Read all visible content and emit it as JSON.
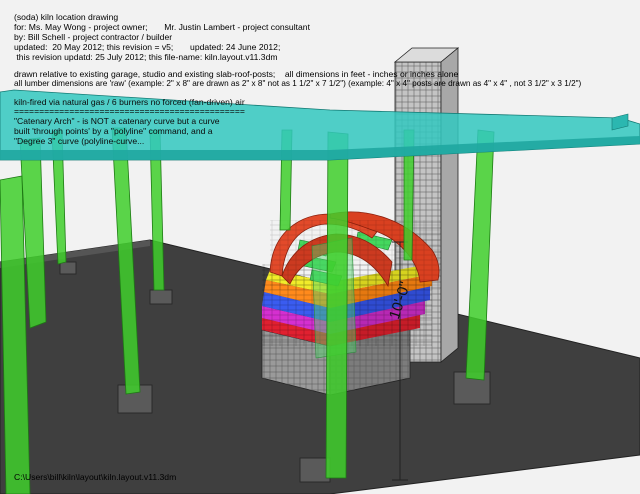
{
  "header": {
    "line1": "(soda) kiln location drawing",
    "line2": "for: Ms. May Wong - project owner;       Mr. Justin Lambert - project consultant",
    "line3": "by: Bill Schell - project contractor / builder",
    "line4": "updated:  20 May 2012; this revision = v5;       updated: 24 June 2012;",
    "line5": " this revision updatd: 25 July 2012; this file-name: kiln.layout.v11.3dm"
  },
  "notes": {
    "line1": "drawn relative to existing garage, studio and existing slab-roof-posts;    all dimensions in feet - inches or inches alone",
    "line2": "all lumber dimensions are 'raw' (example: 2\" x 8\" are drawn as 2\" x 8\" not as 1 1/2\" x 7 1/2\") (example: 4\" x 4\" posts are drawn as 4\" x 4\" , not 3 1/2\" x 3 1/2\")"
  },
  "overlay": {
    "line1": "kiln-fired via natural gas / 6 burners no forced (fan-driven) air",
    "line2": "==============================================",
    "line3": "\"Catenary Arch\" - is NOT a catenary curve but a curve",
    "line4": "built 'through points' by a \"polyline\" command, and a",
    "line5": "\"Degree 3\" curve (polyline-curve..."
  },
  "dimension_label": "10'-0\"",
  "file_path": "C:\\Users\\bill\\kiln\\layout\\kiln.layout.v11.3dm",
  "colors": {
    "background": "#f2f2f2",
    "floor_slab": "#3f3f3f",
    "roof_slab": "#33c8c0",
    "posts": "#3fcf2c",
    "chimney": "#c8c8c8",
    "arch": "#d94020",
    "kiln_red": "#e02030",
    "kiln_magenta": "#d52fd0",
    "kiln_blue": "#3a5cf0",
    "kiln_orange": "#ff8a1c",
    "kiln_yellow": "#f1ec2a",
    "kiln_green": "#44d85e",
    "base": "#8a8a8a"
  }
}
